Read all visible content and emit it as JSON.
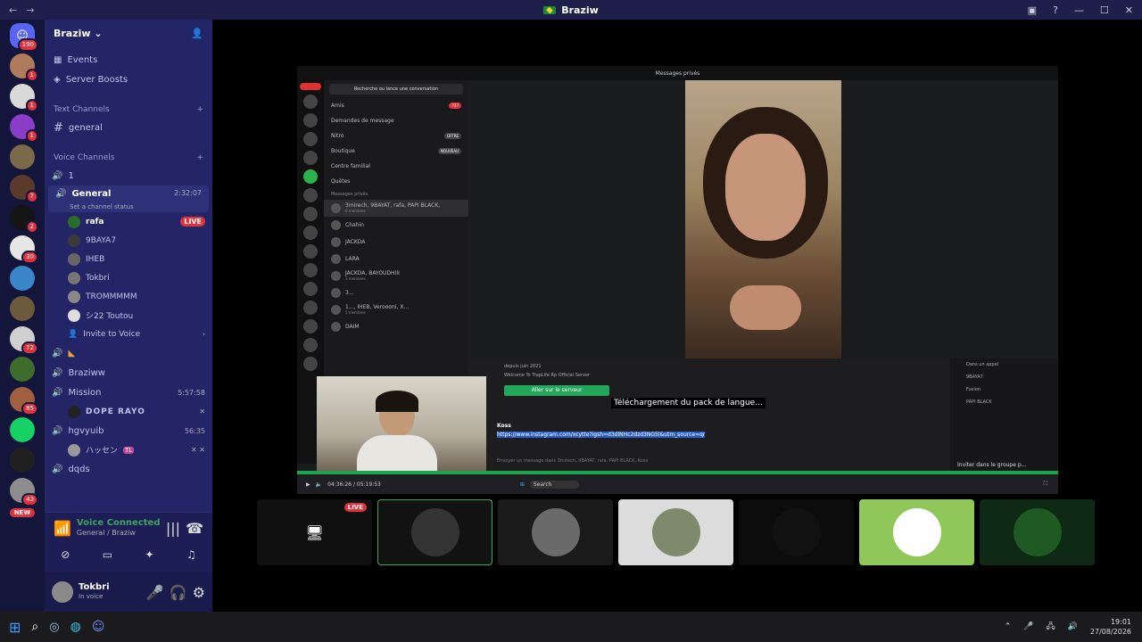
{
  "window": {
    "title": "Braziw"
  },
  "servers": {
    "home_badge": "190",
    "items": [
      {
        "badge": "1",
        "color": "#b07a5c"
      },
      {
        "badge": "1",
        "color": "#d9d9d9"
      },
      {
        "badge": "1",
        "color": "#8b3cc9"
      },
      {
        "badge": "",
        "color": "#7a6a4a"
      },
      {
        "badge": "7",
        "color": "#5a3b2b"
      },
      {
        "badge": "2",
        "color": "#151515"
      },
      {
        "badge": "30",
        "color": "#e6e6e6"
      },
      {
        "badge": "",
        "color": "#3a86c9"
      },
      {
        "badge": "",
        "color": "#6b5a3c"
      },
      {
        "badge": "72",
        "color": "#cfcfcf"
      },
      {
        "badge": "",
        "color": "#3e6c2c"
      },
      {
        "badge": "85",
        "color": "#a06040"
      },
      {
        "badge": "",
        "color": "#16d163"
      },
      {
        "badge": "",
        "color": "#202020"
      },
      {
        "badge": "43",
        "color": "#8d8d8d"
      }
    ],
    "new_label": "NEW"
  },
  "guild": {
    "name": "Braziw",
    "events": "Events",
    "boosts": "Server Boosts",
    "text_category": "Text Channels",
    "text_channels": [
      "general"
    ],
    "voice_category": "Voice Channels",
    "voice_channel_1": "1",
    "general": {
      "name": "General",
      "time": "2:32:07",
      "status": "Set a channel status"
    },
    "general_users": [
      {
        "name": "rafa",
        "live": "LIVE"
      },
      {
        "name": "9BAYA7"
      },
      {
        "name": "IHEB"
      },
      {
        "name": "Tokbri"
      },
      {
        "name": "TROMMMMM"
      },
      {
        "name": "シ22 Toutou"
      }
    ],
    "invite": "Invite to Voice",
    "braziww": "Braziww",
    "mission": {
      "name": "Mission",
      "time": "5:57:58"
    },
    "mission_user": "DOPE RAYO",
    "hgvyuib": {
      "name": "hgvyuib",
      "time": "56:35"
    },
    "hgvyuib_user": "ハッセン",
    "hgvyuib_tag": "TL",
    "dqds": "dqds"
  },
  "voice_panel": {
    "status": "Voice Connected",
    "location": "General / Braziw"
  },
  "user_panel": {
    "name": "Tokbri",
    "status": "In voice"
  },
  "stream": {
    "inner_title": "Messages privés",
    "search": "Recherche ou lance une conversation",
    "menu": [
      {
        "label": "Amis",
        "tag": "737"
      },
      {
        "label": "Demandes de message",
        "tag": ""
      },
      {
        "label": "Nitro",
        "tag": "OFFRE"
      },
      {
        "label": "Boutique",
        "tag": "NOUVEAU"
      },
      {
        "label": "Centre familial",
        "tag": ""
      },
      {
        "label": "Quêtes",
        "tag": ""
      }
    ],
    "dm_header": "Messages privés",
    "dms": [
      {
        "name": "3mirech, 9BAYAT, rafa, PAPI BLACK,",
        "sub": "6 membres"
      },
      {
        "name": "Chahin",
        "sub": ""
      },
      {
        "name": "JACKDA",
        "sub": ""
      },
      {
        "name": "LARA",
        "sub": ""
      },
      {
        "name": "JACKDA, BAYOUDHIII",
        "sub": "3 membres"
      },
      {
        "name": "3...",
        "sub": ""
      },
      {
        "name": "1..., IHEB, Veroooni, X...",
        "sub": "5 membres"
      },
      {
        "name": "DAIM",
        "sub": ""
      }
    ],
    "server_info": "depuis juin 2021",
    "server_welcome": "Welcome To TrapLife Rp Official Server",
    "server_button": "Aller sur le serveur",
    "download_toast": "Téléchargement du pack de langue...",
    "chat_user": "Koss",
    "chat_link": "https://www.instagram.com/xcytte?igsh=d3dlNHc2dzd3NG5l&utm_source=qr",
    "chat_placeholder": "Envoyer un message dans 3mirech, 9BAYAT, rafa, PAPI BLACK, Koss",
    "right_list": [
      "Dans un appel",
      "9BAYA7",
      "Fusion",
      "PAPI BLACK"
    ],
    "invite_group": "Inviter dans le groupe p...",
    "player_time": "04:36:26 / 05:19:53",
    "task_search": "Search"
  },
  "thumbs": {
    "live": "LIVE"
  },
  "taskbar": {
    "time": "19:01",
    "date": "27/08/2026"
  }
}
